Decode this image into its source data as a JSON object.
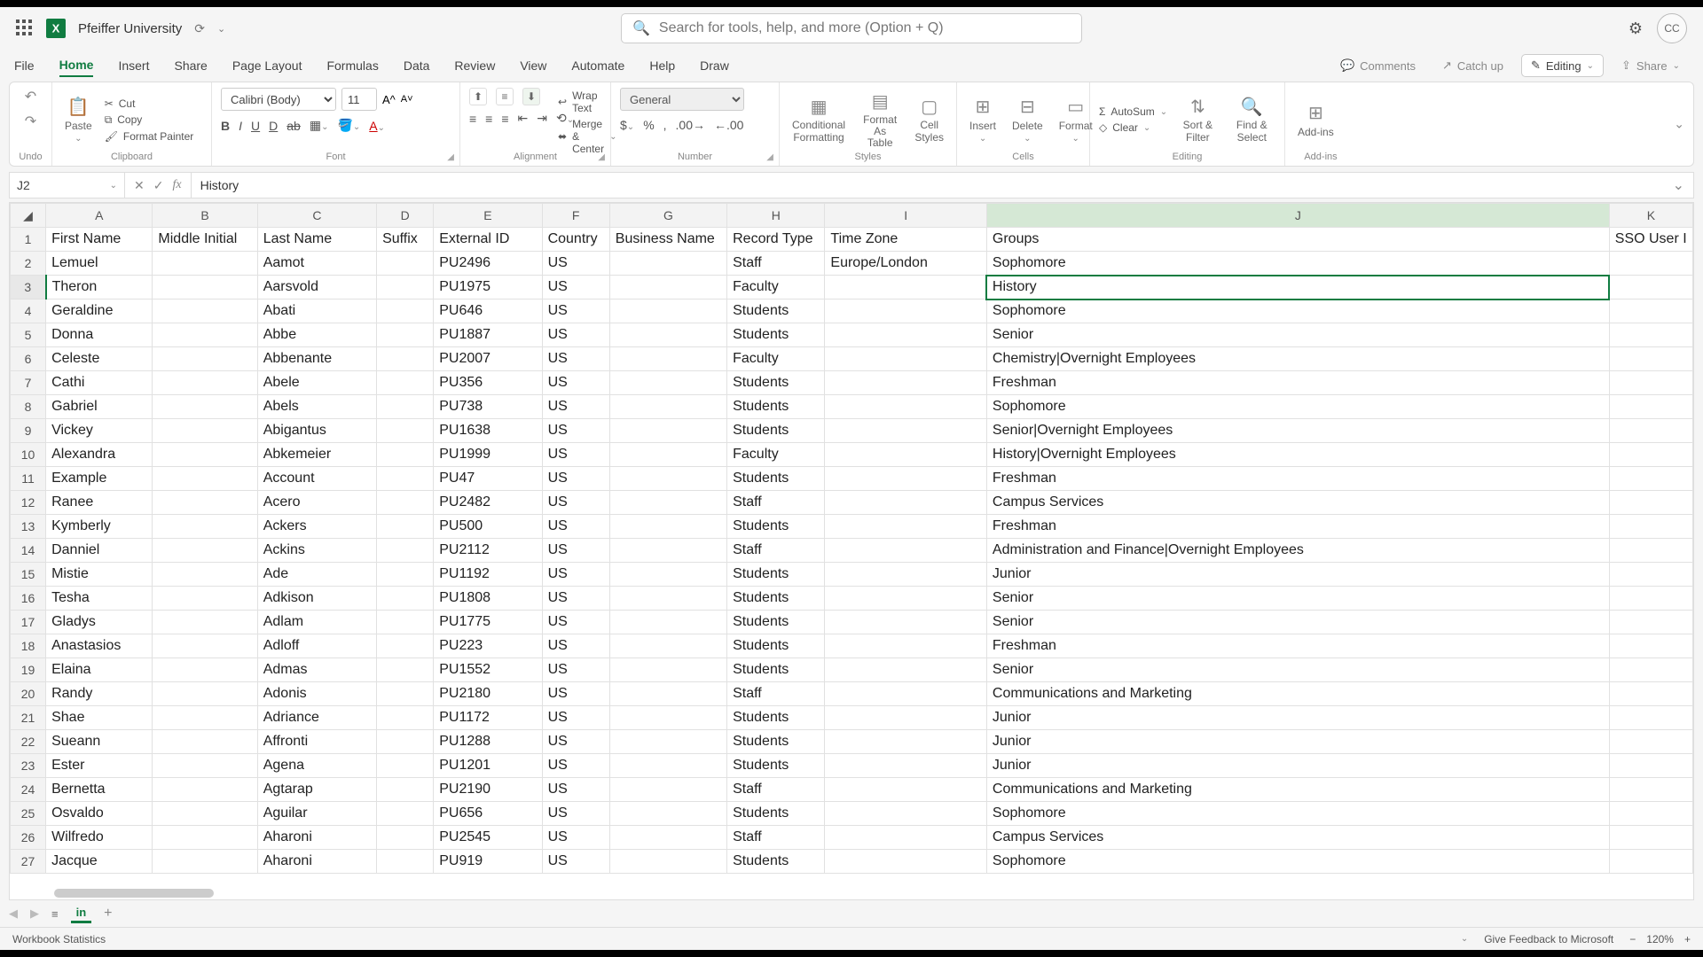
{
  "title": "Pfeiffer University",
  "search_placeholder": "Search for tools, help, and more (Option + Q)",
  "avatar": "CC",
  "tabs": [
    "File",
    "Home",
    "Insert",
    "Share",
    "Page Layout",
    "Formulas",
    "Data",
    "Review",
    "View",
    "Automate",
    "Help",
    "Draw"
  ],
  "active_tab": "Home",
  "right_pills": {
    "comments": "Comments",
    "catchup": "Catch up",
    "editing": "Editing",
    "share": "Share"
  },
  "clipboard": {
    "paste": "Paste",
    "cut": "Cut",
    "copy": "Copy",
    "fp": "Format Painter",
    "label": "Clipboard"
  },
  "undo_label": "Undo",
  "font": {
    "name": "Calibri (Body)",
    "size": "11",
    "label": "Font"
  },
  "alignment": {
    "wrap": "Wrap Text",
    "merge": "Merge & Center",
    "label": "Alignment"
  },
  "number": {
    "general": "General",
    "label": "Number"
  },
  "styles": {
    "cond": "Conditional Formatting",
    "fat": "Format As Table",
    "cell": "Cell Styles",
    "label": "Styles"
  },
  "cells": {
    "ins": "Insert",
    "del": "Delete",
    "fmt": "Format",
    "label": "Cells"
  },
  "editing": {
    "autosum": "AutoSum",
    "clear": "Clear",
    "sort": "Sort & Filter",
    "find": "Find & Select",
    "label": "Editing"
  },
  "addins": {
    "btn": "Add-ins",
    "label": "Add-ins"
  },
  "namebox": "J2",
  "formula": "History",
  "columns": [
    "A",
    "B",
    "C",
    "D",
    "E",
    "F",
    "G",
    "H",
    "I",
    "J",
    "K"
  ],
  "headerK": "SSO User I",
  "headers": {
    "A": "First Name",
    "B": "Middle Initial",
    "C": "Last Name",
    "D": "Suffix",
    "E": "External ID",
    "F": "Country",
    "G": "Business Name",
    "H": "Record Type",
    "I": "Time Zone",
    "J": "Groups"
  },
  "rows": [
    {
      "n": 2,
      "A": "Lemuel",
      "C": "Aamot",
      "E": "PU2496",
      "F": "US",
      "H": "Staff",
      "I": "Europe/London",
      "J": "Sophomore"
    },
    {
      "n": 3,
      "A": "Theron",
      "C": "Aarsvold",
      "E": "PU1975",
      "F": "US",
      "H": "Faculty",
      "J": "History"
    },
    {
      "n": 4,
      "A": "Geraldine",
      "C": "Abati",
      "E": "PU646",
      "F": "US",
      "H": "Students",
      "J": "Sophomore"
    },
    {
      "n": 5,
      "A": "Donna",
      "C": "Abbe",
      "E": "PU1887",
      "F": "US",
      "H": "Students",
      "J": "Senior"
    },
    {
      "n": 6,
      "A": "Celeste",
      "C": "Abbenante",
      "E": "PU2007",
      "F": "US",
      "H": "Faculty",
      "J": "Chemistry|Overnight Employees"
    },
    {
      "n": 7,
      "A": "Cathi",
      "C": "Abele",
      "E": "PU356",
      "F": "US",
      "H": "Students",
      "J": "Freshman"
    },
    {
      "n": 8,
      "A": "Gabriel",
      "C": "Abels",
      "E": "PU738",
      "F": "US",
      "H": "Students",
      "J": "Sophomore"
    },
    {
      "n": 9,
      "A": "Vickey",
      "C": "Abigantus",
      "E": "PU1638",
      "F": "US",
      "H": "Students",
      "J": "Senior|Overnight Employees"
    },
    {
      "n": 10,
      "A": "Alexandra",
      "C": "Abkemeier",
      "E": "PU1999",
      "F": "US",
      "H": "Faculty",
      "J": "History|Overnight Employees"
    },
    {
      "n": 11,
      "A": "Example",
      "C": "Account",
      "E": "PU47",
      "F": "US",
      "H": "Students",
      "J": "Freshman"
    },
    {
      "n": 12,
      "A": "Ranee",
      "C": "Acero",
      "E": "PU2482",
      "F": "US",
      "H": "Staff",
      "J": "Campus Services"
    },
    {
      "n": 13,
      "A": "Kymberly",
      "C": "Ackers",
      "E": "PU500",
      "F": "US",
      "H": "Students",
      "J": "Freshman"
    },
    {
      "n": 14,
      "A": "Danniel",
      "C": "Ackins",
      "E": "PU2112",
      "F": "US",
      "H": "Staff",
      "J": "Administration and Finance|Overnight Employees"
    },
    {
      "n": 15,
      "A": "Mistie",
      "C": "Ade",
      "E": "PU1192",
      "F": "US",
      "H": "Students",
      "J": "Junior"
    },
    {
      "n": 16,
      "A": "Tesha",
      "C": "Adkison",
      "E": "PU1808",
      "F": "US",
      "H": "Students",
      "J": "Senior"
    },
    {
      "n": 17,
      "A": "Gladys",
      "C": "Adlam",
      "E": "PU1775",
      "F": "US",
      "H": "Students",
      "J": "Senior"
    },
    {
      "n": 18,
      "A": "Anastasios",
      "C": "Adloff",
      "E": "PU223",
      "F": "US",
      "H": "Students",
      "J": "Freshman"
    },
    {
      "n": 19,
      "A": "Elaina",
      "C": "Admas",
      "E": "PU1552",
      "F": "US",
      "H": "Students",
      "J": "Senior"
    },
    {
      "n": 20,
      "A": "Randy",
      "C": "Adonis",
      "E": "PU2180",
      "F": "US",
      "H": "Staff",
      "J": "Communications and Marketing"
    },
    {
      "n": 21,
      "A": "Shae",
      "C": "Adriance",
      "E": "PU1172",
      "F": "US",
      "H": "Students",
      "J": "Junior"
    },
    {
      "n": 22,
      "A": "Sueann",
      "C": "Affronti",
      "E": "PU1288",
      "F": "US",
      "H": "Students",
      "J": "Junior"
    },
    {
      "n": 23,
      "A": "Ester",
      "C": "Agena",
      "E": "PU1201",
      "F": "US",
      "H": "Students",
      "J": "Junior"
    },
    {
      "n": 24,
      "A": "Bernetta",
      "C": "Agtarap",
      "E": "PU2190",
      "F": "US",
      "H": "Staff",
      "J": "Communications and Marketing"
    },
    {
      "n": 25,
      "A": "Osvaldo",
      "C": "Aguilar",
      "E": "PU656",
      "F": "US",
      "H": "Students",
      "J": "Sophomore"
    },
    {
      "n": 26,
      "A": "Wilfredo",
      "C": "Aharoni",
      "E": "PU2545",
      "F": "US",
      "H": "Staff",
      "J": "Campus Services"
    },
    {
      "n": 27,
      "A": "Jacque",
      "C": "Aharoni",
      "E": "PU919",
      "F": "US",
      "H": "Students",
      "J": "Sophomore"
    }
  ],
  "selected_cell": "J2",
  "selected_row": 3,
  "sheet": {
    "name": "in"
  },
  "status": {
    "stats": "Workbook Statistics",
    "feedback": "Give Feedback to Microsoft",
    "zoom": "120%"
  }
}
